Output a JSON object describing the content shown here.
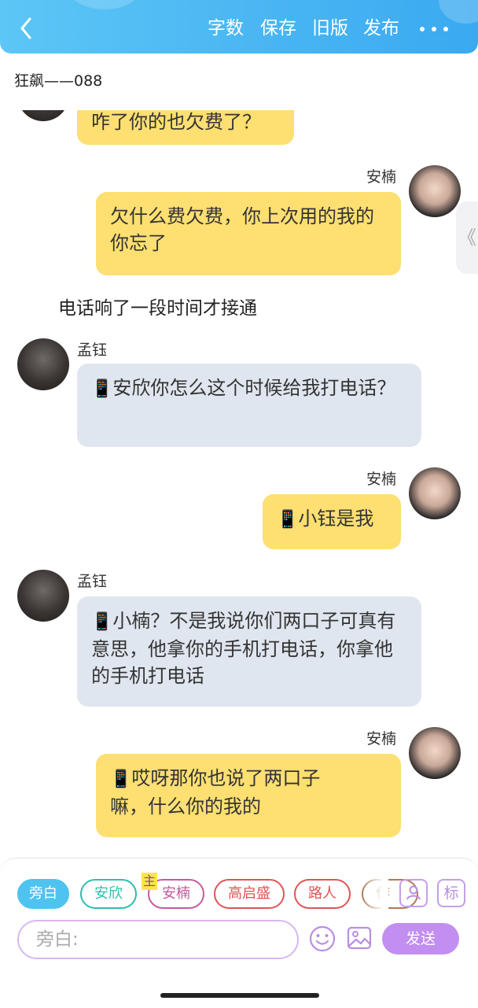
{
  "toolbar": {
    "word_count": "字数",
    "save": "保存",
    "old_version": "旧版",
    "publish": "发布"
  },
  "document": {
    "title": "狂飙——088"
  },
  "messages": [
    {
      "speaker": "",
      "side": "right",
      "text": "咋了你的也欠费了？"
    },
    {
      "speaker": "安楠",
      "side": "right",
      "text": "欠什么费欠费，你上次用的我的你忘了"
    },
    {
      "type": "narration",
      "text": "电话响了一段时间才接通"
    },
    {
      "speaker": "孟钰",
      "side": "left",
      "text": "安欣你怎么这个时候给我打电话？"
    },
    {
      "speaker": "安楠",
      "side": "right",
      "text": "小钰是我"
    },
    {
      "speaker": "孟钰",
      "side": "left",
      "text": "小楠？不是我说你们两口子可真有意思，他拿你的手机打电话，你拿他的手机打电话"
    },
    {
      "speaker": "安楠",
      "side": "right",
      "text": "哎呀那你也说了两口子嘛，什么你的我的"
    }
  ],
  "message_icon": "📱",
  "side_tab_glyph": "《",
  "roles": [
    {
      "label": "旁白",
      "color": "#4fc3f0",
      "selected": true
    },
    {
      "label": "安欣",
      "color": "#2bbfae",
      "selected": false
    },
    {
      "label": "安楠",
      "color": "#c35a9e",
      "selected": false,
      "badge": "主"
    },
    {
      "label": "高启盛",
      "color": "#e05555",
      "selected": false
    },
    {
      "label": "路人",
      "color": "#e05555",
      "selected": false
    },
    {
      "label": "作",
      "color": "#b07a55",
      "selected": false
    }
  ],
  "tools": {
    "character_icon": "person-card-icon",
    "tag_label": "标"
  },
  "composer": {
    "placeholder": "旁白:",
    "send_label": "发送"
  },
  "colors": {
    "accent": "#3aa9f0",
    "my_bubble": "#fddf72",
    "other_bubble": "#e0e6ef",
    "send": "#c28ef0"
  }
}
